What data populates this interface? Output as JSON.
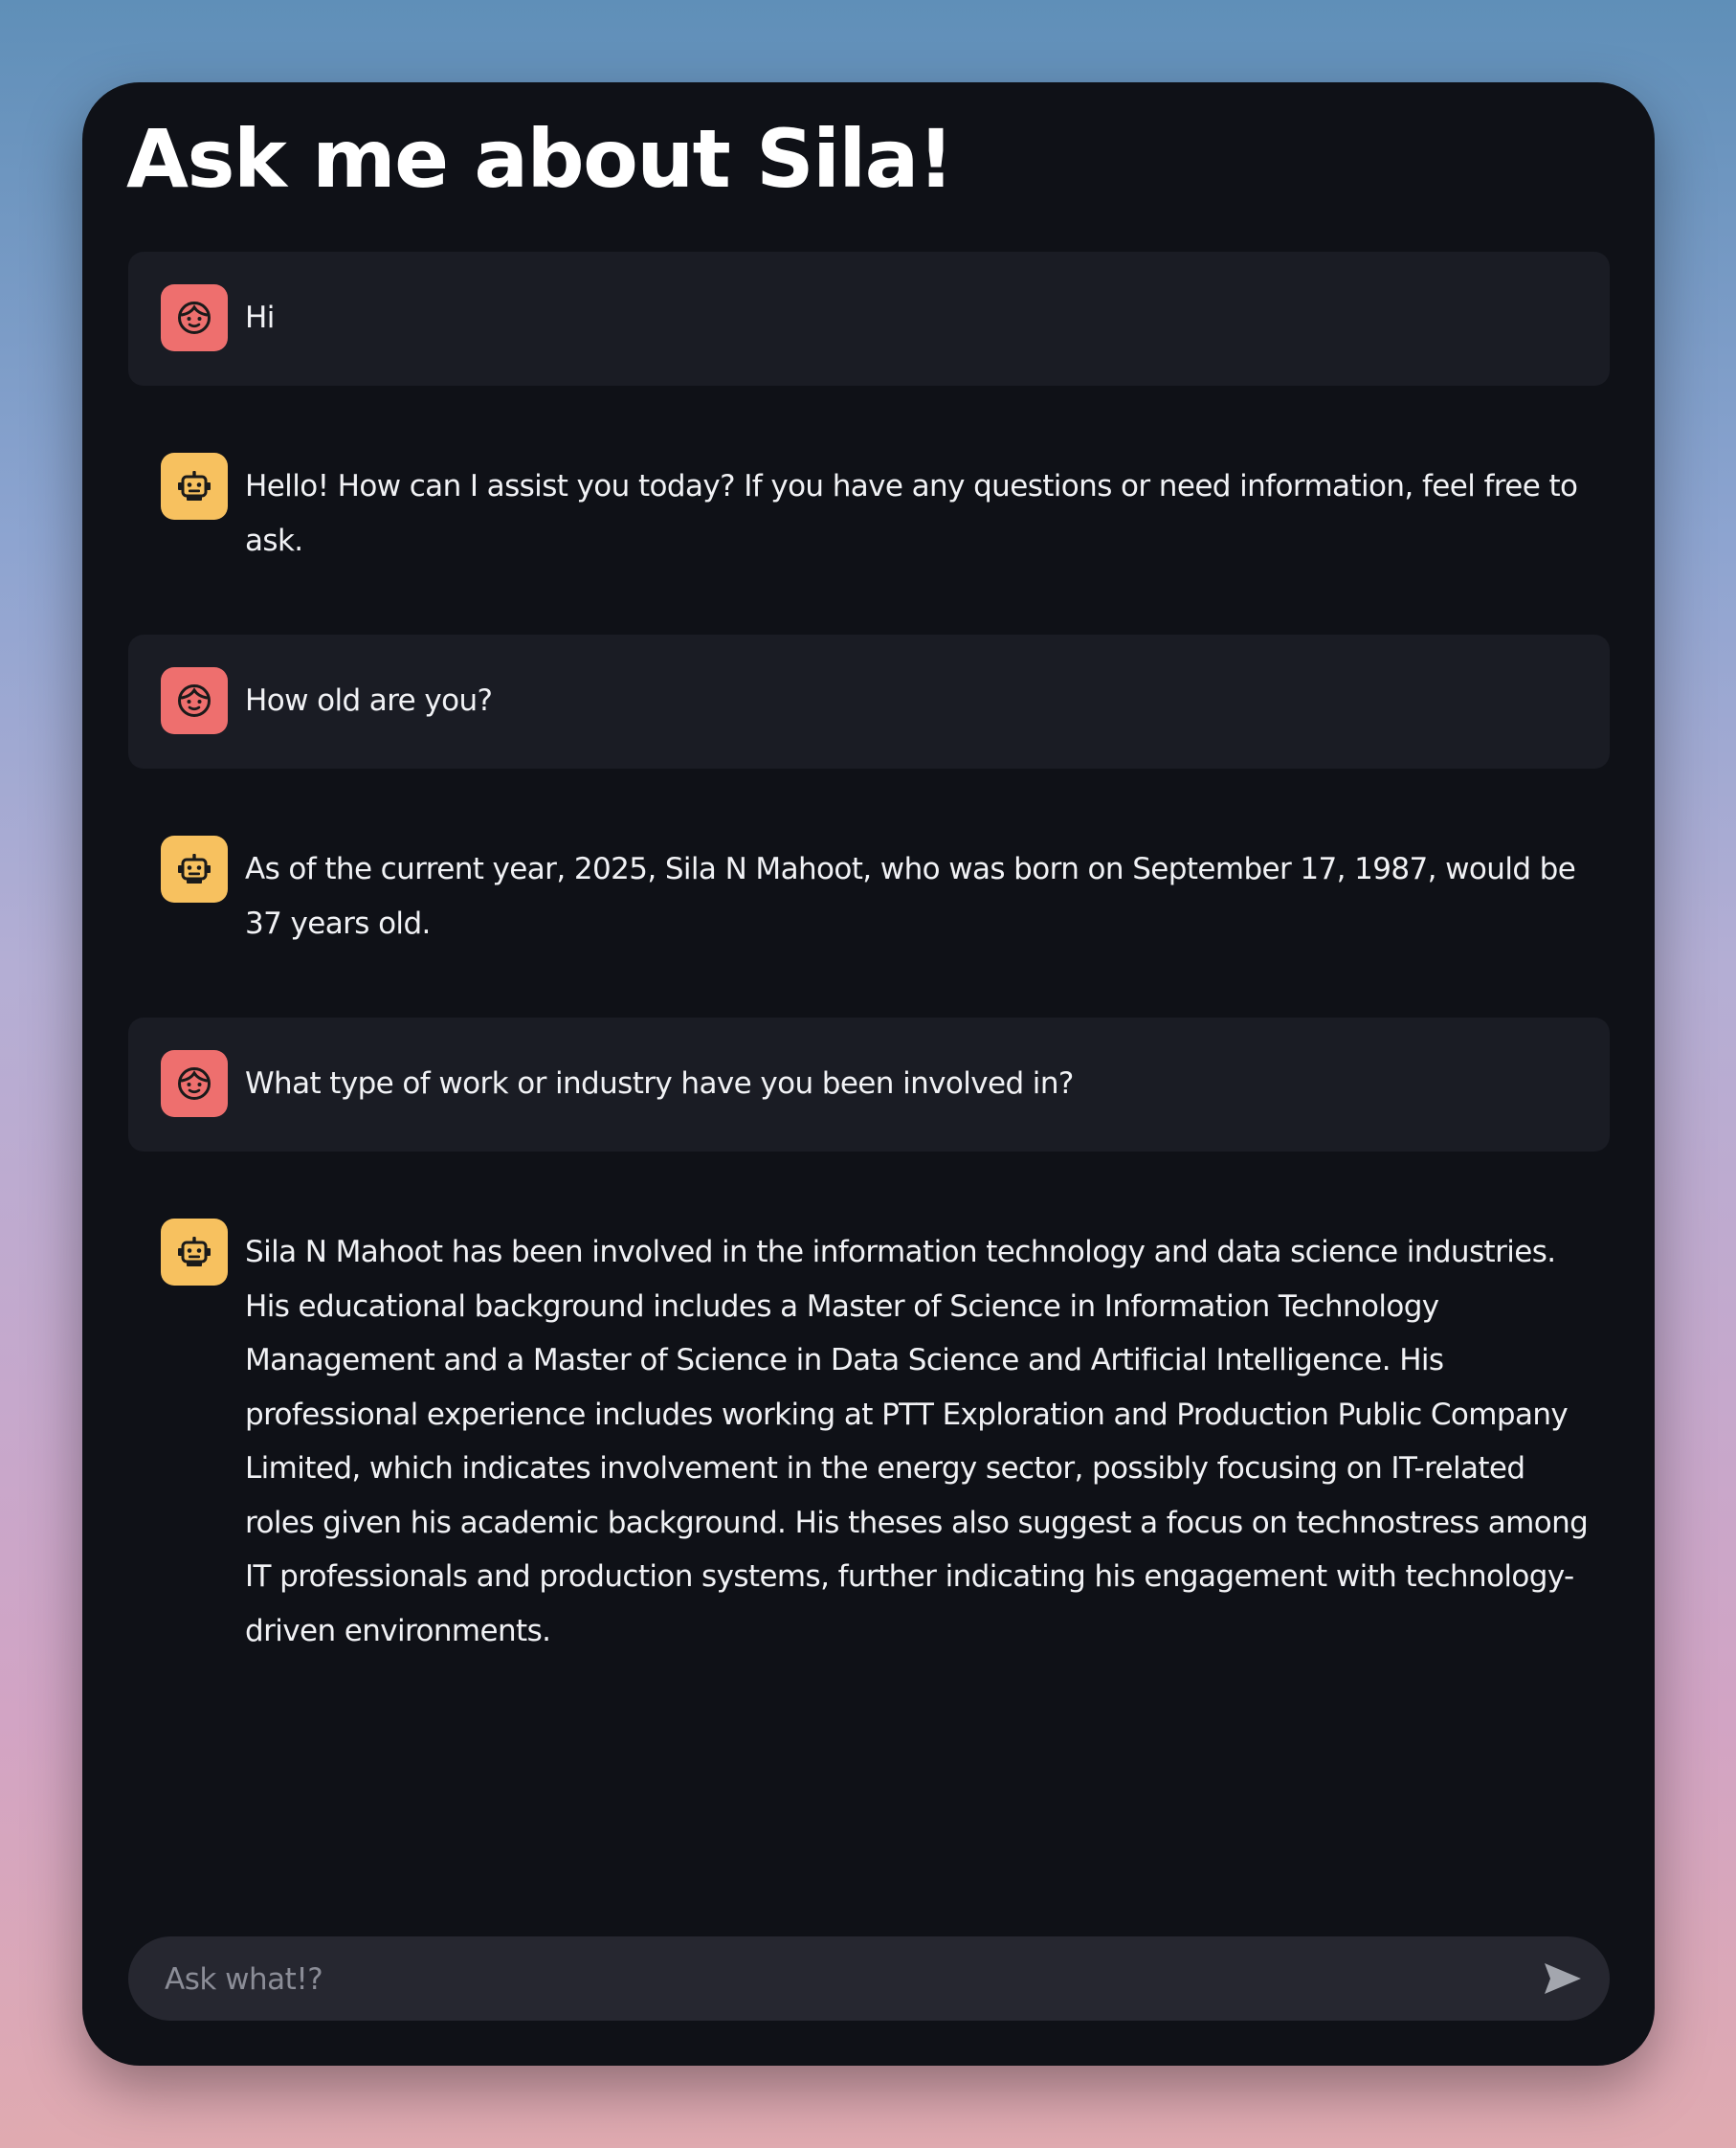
{
  "app": {
    "title": "Ask me about Sila!"
  },
  "messages": [
    {
      "role": "user",
      "avatar_icon": "user-face-icon",
      "text": "Hi"
    },
    {
      "role": "assistant",
      "avatar_icon": "robot-icon",
      "text": "Hello! How can I assist you today? If you have any questions or need information, feel free to ask."
    },
    {
      "role": "user",
      "avatar_icon": "user-face-icon",
      "text": "How old are you?"
    },
    {
      "role": "assistant",
      "avatar_icon": "robot-icon",
      "text": "As of the current year, 2025, Sila N Mahoot, who was born on September 17, 1987, would be 37 years old."
    },
    {
      "role": "user",
      "avatar_icon": "user-face-icon",
      "text": "What type of work or industry have you been involved in?"
    },
    {
      "role": "assistant",
      "avatar_icon": "robot-icon",
      "text": "Sila N Mahoot has been involved in the information technology and data science industries. His educational background includes a Master of Science in Information Technology Management and a Master of Science in Data Science and Artificial Intelligence. His professional experience includes working at PTT Exploration and Production Public Company Limited, which indicates involvement in the energy sector, possibly focusing on IT-related roles given his academic background. His theses also suggest a focus on technostress among IT professionals and production systems, further indicating his engagement with technology-driven environments."
    }
  ],
  "chat_input": {
    "value": "",
    "placeholder": "Ask what!?",
    "send_icon": "send-arrow-icon"
  },
  "colors": {
    "window_bg": "#0f1117",
    "user_bubble_bg": "#1a1c24",
    "user_avatar": "#ee6f6e",
    "bot_avatar": "#f7c15f",
    "input_bg": "#262730"
  }
}
